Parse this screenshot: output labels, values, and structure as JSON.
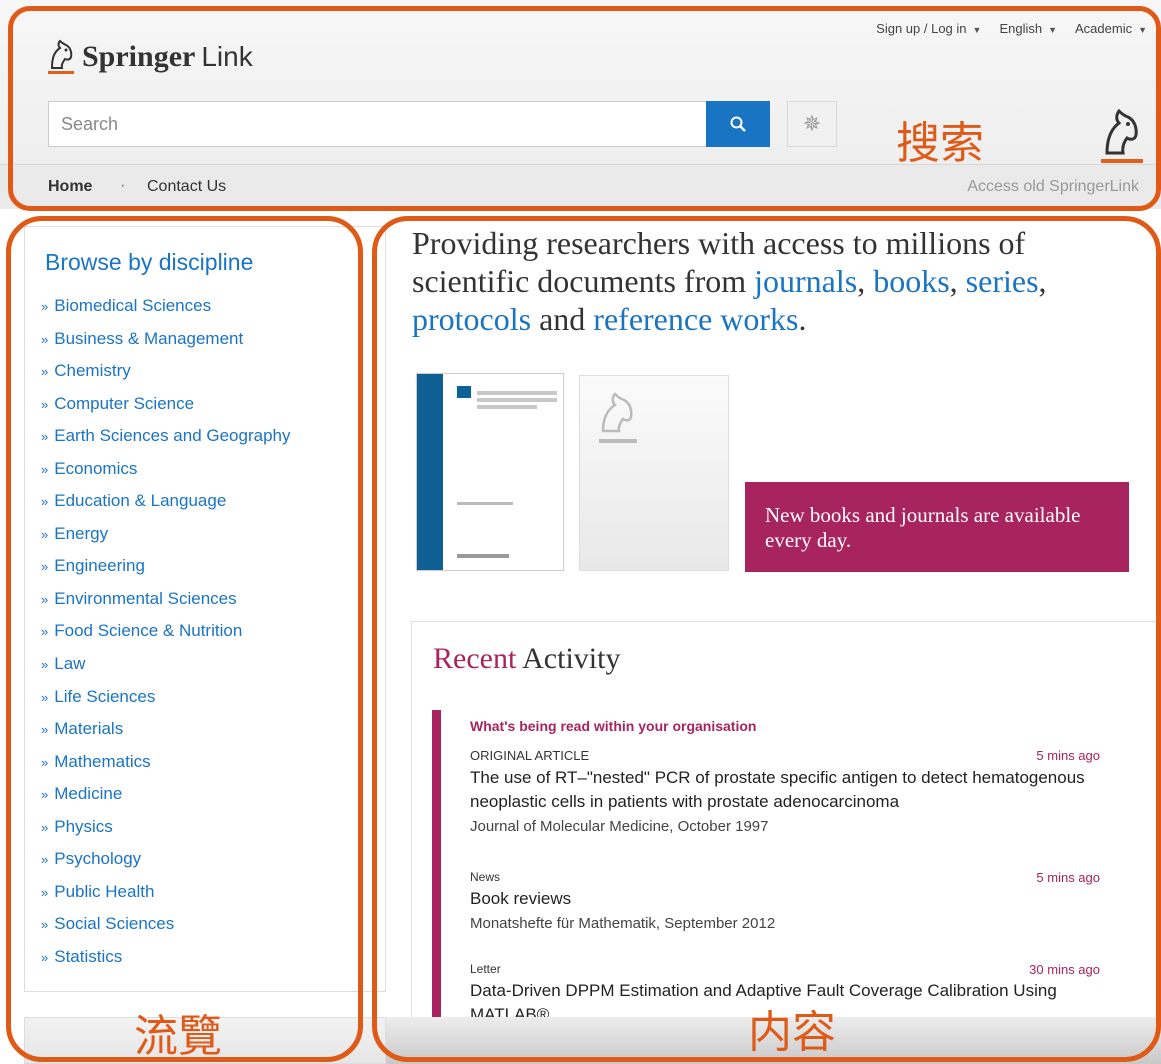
{
  "header": {
    "logo_text": "Springer",
    "logo_link": "Link",
    "topnav": {
      "signup": "Sign up / Log in",
      "language": "English",
      "mode": "Academic"
    },
    "search": {
      "placeholder": "Search"
    },
    "subnav": {
      "home": "Home",
      "separator": "·",
      "contact": "Contact Us",
      "old_link": "Access old SpringerLink"
    }
  },
  "sidebar": {
    "heading": "Browse by discipline",
    "items": [
      "Biomedical Sciences",
      "Business & Management",
      "Chemistry",
      "Computer Science",
      "Earth Sciences and Geography",
      "Economics",
      "Education & Language",
      "Energy",
      "Engineering",
      "Environmental Sciences",
      "Food Science & Nutrition",
      "Law",
      "Life Sciences",
      "Materials",
      "Mathematics",
      "Medicine",
      "Physics",
      "Psychology",
      "Public Health",
      "Social Sciences",
      "Statistics"
    ]
  },
  "main": {
    "tagline": {
      "pre": "Providing researchers with access to millions of scientific documents from ",
      "journals": "journals",
      "sep1": ", ",
      "books": "books",
      "sep2": ", ",
      "series": "series",
      "sep3": ", ",
      "protocols": "protocols",
      "and": " and ",
      "reference": "reference works",
      "end": "."
    },
    "promo": "New books and journals are available every day.",
    "activity": {
      "title_colored": "Recent",
      "title_rest": " Activity",
      "group": "What's being read within your organisation",
      "items": [
        {
          "type": "ORIGINAL ARTICLE",
          "ago": "5 mins ago",
          "title": "The use of RT–\"nested\" PCR of prostate specific antigen to detect hematogenous neoplastic cells in patients with prostate adenocarcinoma",
          "source": "Journal of Molecular Medicine, October 1997"
        },
        {
          "type": "News",
          "ago": "5 mins ago",
          "title": "Book reviews",
          "source": "Monatshefte für Mathematik, September 2012"
        },
        {
          "type": "Letter",
          "ago": "30 mins ago",
          "title": "Data-Driven DPPM Estimation and Adaptive Fault Coverage Calibration Using MATLAB®",
          "source": ""
        }
      ]
    }
  },
  "annotations": {
    "search": "搜索",
    "browse": "流覽",
    "content": "内容",
    "color": "#e05a17"
  },
  "colors": {
    "link": "#1a74c4",
    "accent": "#a8245e",
    "search_button": "#1a74c4"
  }
}
